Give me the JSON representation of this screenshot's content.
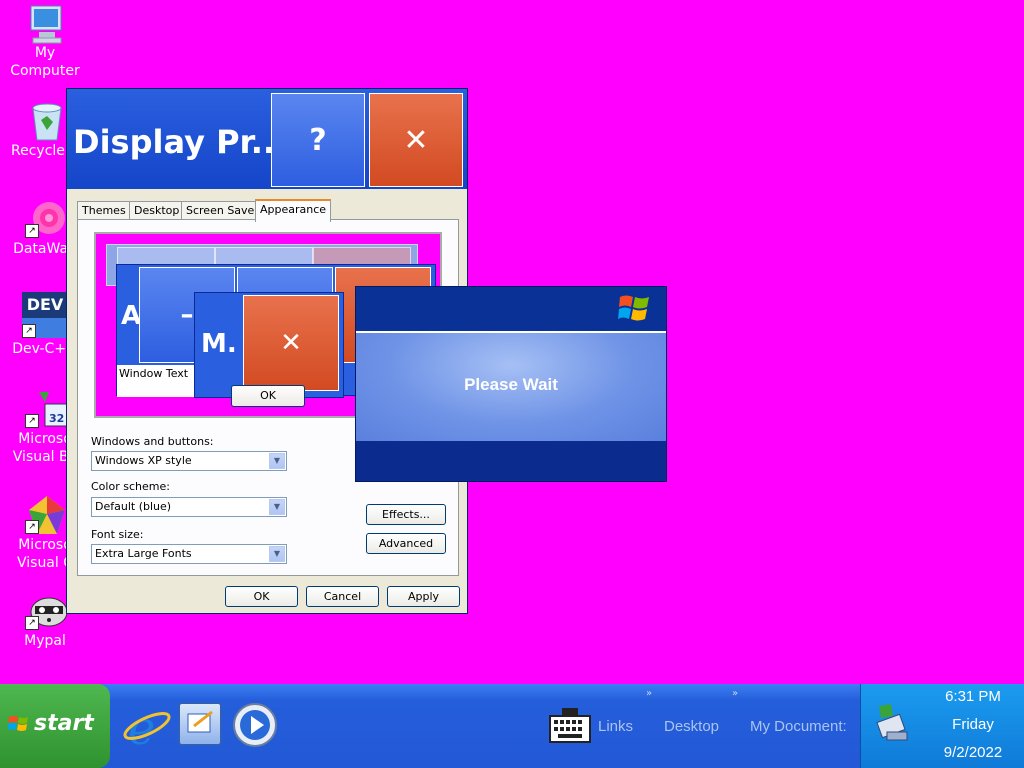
{
  "desktop": {
    "background_color": "#ff00ff",
    "icons": [
      {
        "name": "my-computer",
        "label_line1": "My",
        "label_line2": "Computer"
      },
      {
        "name": "recycle-bin",
        "label_line1": "Recycle B",
        "label_line2": ""
      },
      {
        "name": "datawag",
        "label_line1": "DataWag",
        "label_line2": ""
      },
      {
        "name": "dev-cpp",
        "label_line1": "Dev-C++",
        "label_line2": "",
        "icon_text": "DEV"
      },
      {
        "name": "ms-visual-basic",
        "label_line1": "Microso",
        "label_line2": "Visual Ba",
        "icon_text": "32"
      },
      {
        "name": "ms-visual-c",
        "label_line1": "Microso",
        "label_line2": "Visual C",
        "icon_text": ""
      },
      {
        "name": "mypal",
        "label_line1": "Mypal",
        "label_line2": ""
      }
    ]
  },
  "dialog": {
    "title": "Display Pr...",
    "help_label": "?",
    "close_label": "✕",
    "tabs": [
      "Themes",
      "Desktop",
      "Screen Saver",
      "Appearance"
    ],
    "active_tab": "Appearance",
    "preview": {
      "window_text": "Window Text",
      "inactive_letter": "A",
      "minimize_label": "–",
      "message_title": "M.",
      "message_close": "✕",
      "ok_label": "OK"
    },
    "windows_buttons_label": "Windows and buttons:",
    "windows_buttons_value": "Windows XP style",
    "color_scheme_label": "Color scheme:",
    "color_scheme_value": "Default (blue)",
    "font_size_label": "Font size:",
    "font_size_value": "Extra Large Fonts",
    "effects_label": "Effects...",
    "advanced_label": "Advanced",
    "ok_label": "OK",
    "cancel_label": "Cancel",
    "apply_label": "Apply"
  },
  "please_wait": {
    "text": "Please Wait"
  },
  "taskbar": {
    "start_label": "start",
    "quicklaunch": [
      "internet-explorer-icon",
      "outlook-express-icon",
      "media-player-icon"
    ],
    "toolbar_links": [
      "Links",
      "Desktop",
      "My Document:"
    ],
    "chevron": "»",
    "clock_time": "6:31 PM",
    "clock_day": "Friday",
    "clock_date": "9/2/2022"
  }
}
